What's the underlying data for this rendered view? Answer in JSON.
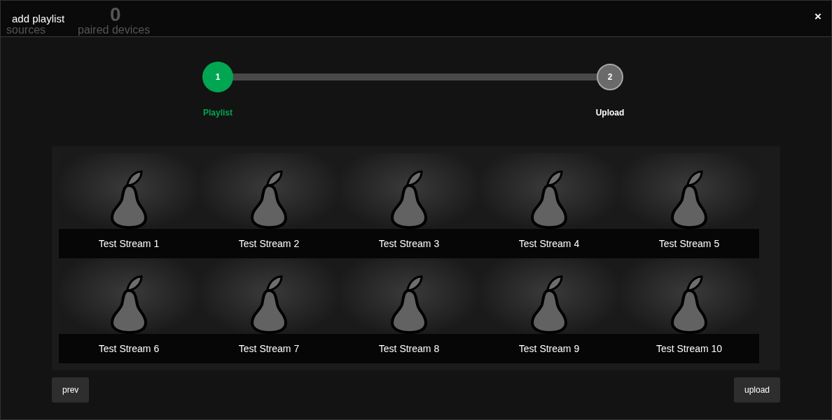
{
  "background_page": {
    "stats": [
      {
        "value": "0",
        "label": "paired devices"
      }
    ],
    "sources_label": "sources"
  },
  "dialog": {
    "title": "add playlist",
    "close": "×"
  },
  "steps": [
    {
      "number": "1",
      "label": "Playlist",
      "selected": true
    },
    {
      "number": "2",
      "label": "Upload",
      "selected": false
    }
  ],
  "streams": [
    {
      "name": "Test Stream 1"
    },
    {
      "name": "Test Stream 2"
    },
    {
      "name": "Test Stream 3"
    },
    {
      "name": "Test Stream 4"
    },
    {
      "name": "Test Stream 5"
    },
    {
      "name": "Test Stream 6"
    },
    {
      "name": "Test Stream 7"
    },
    {
      "name": "Test Stream 8"
    },
    {
      "name": "Test Stream 9"
    },
    {
      "name": "Test Stream 10"
    }
  ],
  "buttons": {
    "prev": "prev",
    "next": "upload"
  }
}
